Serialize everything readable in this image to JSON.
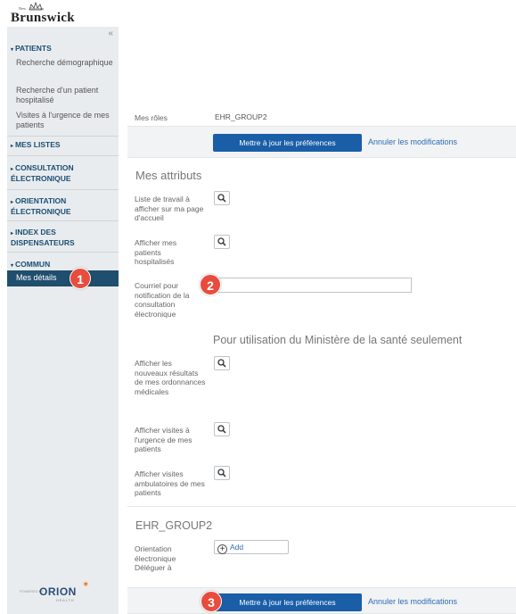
{
  "header": {
    "logo_small": "New · Nouveau",
    "logo_big": "Brunswick"
  },
  "sidebar": {
    "collapse_icon": "«",
    "sections": [
      {
        "title": "PATIENTS",
        "expanded": true,
        "items": [
          "Recherche démographique",
          "Recherche d'un patient hospitalisé",
          "Visites à l'urgence de mes patients"
        ]
      },
      {
        "title": "MES LISTES",
        "expanded": false
      },
      {
        "title": "CONSULTATION ÉLECTRONIQUE",
        "expanded": false
      },
      {
        "title": "ORIENTATION ÉLECTRONIQUE",
        "expanded": false
      },
      {
        "title": "INDEX DES DISPENSATEURS",
        "expanded": false
      },
      {
        "title": "COMMUN",
        "expanded": true,
        "items": [
          "Mes détails"
        ]
      }
    ],
    "selected_item": "Mes détails",
    "footer": {
      "powered": "POWERED BY",
      "brand": "ORION",
      "brand_sub": "HEALTH"
    }
  },
  "main": {
    "roles_label": "Mes rôles",
    "roles_value": "EHR_GROUP2",
    "update_button": "Mettre à jour les préférences",
    "cancel_link": "Annuler les modifications",
    "attributes_title": "Mes attributs",
    "attr1_label": "Liste de travail à afficher sur ma page d'accueil",
    "attr2_label": "Afficher mes patients hospitalisés",
    "attr3_label": "Courriel pour notification de la consultation électronique",
    "attr3_value": "",
    "ministry_title": "Pour utilisation du Ministère de la santé seulement",
    "attr4_label": "Afficher les nouveaux résultats de mes ordonnances médicales",
    "attr5_label": "Afficher visites à l'urgence de mes patients",
    "attr6_label": "Afficher visites ambulatoires de mes patients",
    "group_title": "EHR_GROUP2",
    "delegate_label": "Orientation électronique Déléguer à",
    "add_label": "Add",
    "bottom_update_button": "Mettre à jour les préférences",
    "bottom_cancel_link": "Annuler les modifications"
  },
  "badges": [
    "1",
    "2",
    "3"
  ],
  "colors": {
    "accent": "#1a5ea8",
    "nav": "#1a4f73",
    "selected": "#1f4e6e",
    "badge": "#e84c3d"
  }
}
